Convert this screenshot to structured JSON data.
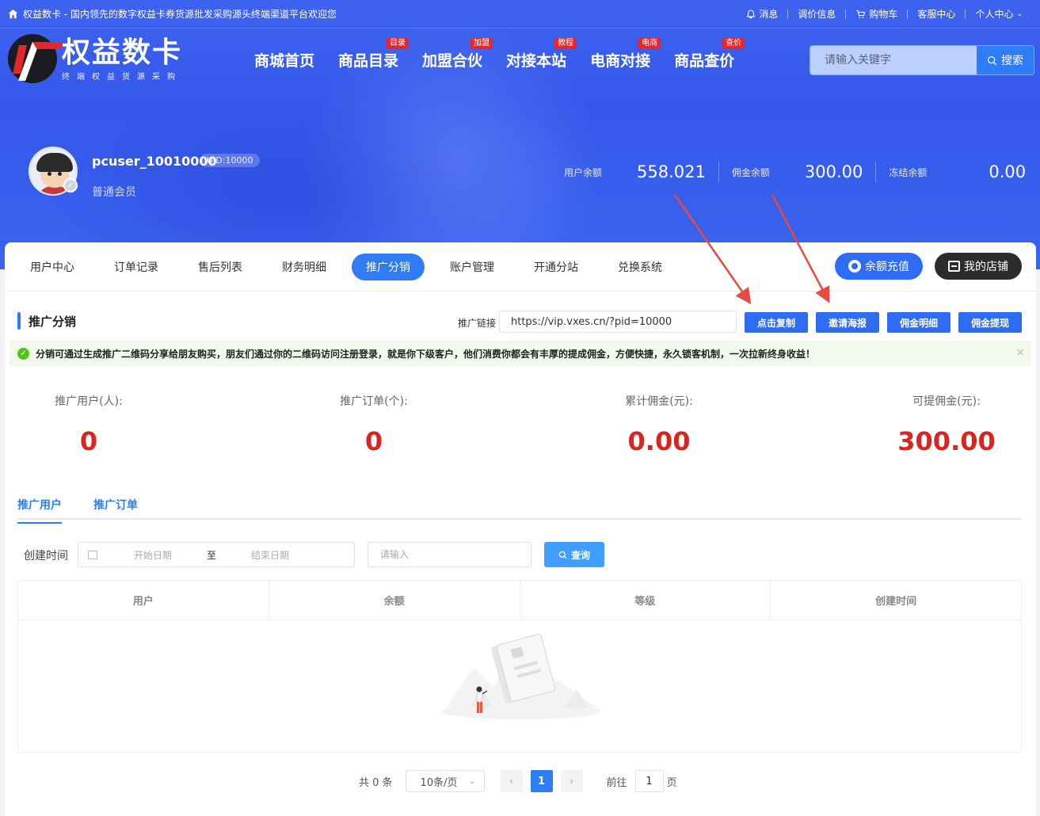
{
  "topbar": {
    "site_text": "权益数卡 - 国内领先的数字权益卡券货源批发采购源头终端渠道平台欢迎您",
    "links": [
      "消息",
      "调价信息",
      "购物车",
      "客服中心",
      "个人中心"
    ]
  },
  "logo": {
    "name": "权益数卡",
    "sub": "终端权益货源采购"
  },
  "main_nav": [
    {
      "label": "商城首页",
      "badge": ""
    },
    {
      "label": "商品目录",
      "badge": "目录"
    },
    {
      "label": "加盟合伙",
      "badge": "加盟"
    },
    {
      "label": "对接本站",
      "badge": "教程"
    },
    {
      "label": "电商对接",
      "badge": "电商"
    },
    {
      "label": "商品查价",
      "badge": "查价"
    }
  ],
  "search": {
    "placeholder": "请输入关键字",
    "button": "搜索"
  },
  "user": {
    "name": "pcuser_10010000",
    "uid": "UID:10000",
    "level": "普通会员",
    "balance_label": "用户余额",
    "balance": "558.021",
    "commission_label": "佣金余额",
    "commission": "300.00",
    "frozen_label": "冻结余额",
    "frozen": "0.00"
  },
  "tabs": [
    "用户中心",
    "订单记录",
    "售后列表",
    "财务明细",
    "推广分销",
    "账户管理",
    "开通分站",
    "兑换系统"
  ],
  "active_tab": "推广分销",
  "actions": {
    "recharge": "余额充值",
    "shop": "我的店铺"
  },
  "section": {
    "title": "推广分销",
    "link_label": "推广链接",
    "link_value": "https://vip.vxes.cn/?pid=10000",
    "buttons": [
      "点击复制",
      "邀请海报",
      "佣金明细",
      "佣金提现"
    ]
  },
  "notice": "分销可通过生成推广二维码分享给朋友购买，朋友们通过你的二维码访问注册登录，就是你下级客户，他们消费你都会有丰厚的提成佣金，方便快捷，永久锁客机制，一次拉新终身收益！",
  "stats": [
    {
      "label": "推广用户(人):",
      "value": "0"
    },
    {
      "label": "推广订单(个):",
      "value": "0"
    },
    {
      "label": "累计佣金(元):",
      "value": "0.00"
    },
    {
      "label": "可提佣金(元):",
      "value": "300.00"
    }
  ],
  "subtabs": [
    "推广用户",
    "推广订单"
  ],
  "filter": {
    "label": "创建时间",
    "start_placeholder": "开始日期",
    "to": "至",
    "end_placeholder": "结束日期",
    "input_placeholder": "请输入",
    "query": "查询"
  },
  "table": {
    "columns": [
      "用户",
      "余额",
      "等级",
      "创建时间"
    ]
  },
  "pager": {
    "total": "共 0 条",
    "page_size": "10条/页",
    "current": "1",
    "goto_label": "前往",
    "goto_value": "1",
    "page_suffix": "页"
  },
  "colors": {
    "primary": "#2e7cf6",
    "hero": "#3a5eee",
    "stat_red": "#d9251d",
    "notice_bg": "#f0f9eb"
  }
}
